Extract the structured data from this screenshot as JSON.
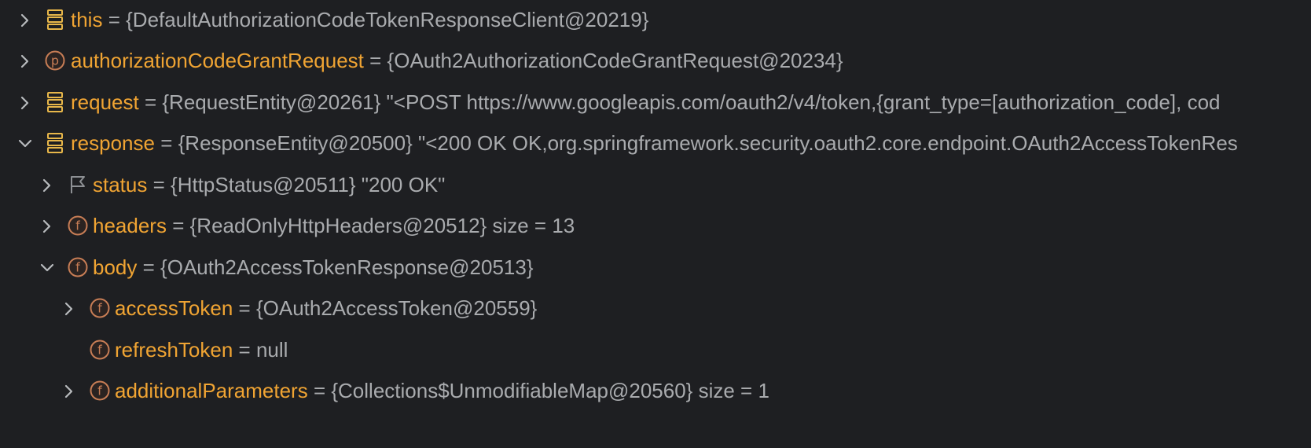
{
  "variables_panel": {
    "rows": [
      {
        "name": "this",
        "value": "= {DefaultAuthorizationCodeTokenResponseClient@20219}",
        "icon": "object-stack-icon",
        "toggle": "collapsed"
      },
      {
        "name": "authorizationCodeGrantRequest",
        "value": "= {OAuth2AuthorizationCodeGrantRequest@20234}",
        "icon": "parameter-icon",
        "icon_letter": "p",
        "toggle": "collapsed"
      },
      {
        "name": "request",
        "value": "= {RequestEntity@20261} \"<POST https://www.googleapis.com/oauth2/v4/token,{grant_type=[authorization_code], cod",
        "icon": "object-stack-icon",
        "toggle": "collapsed"
      },
      {
        "name": "response",
        "value": "= {ResponseEntity@20500} \"<200 OK OK,org.springframework.security.oauth2.core.endpoint.OAuth2AccessTokenRes",
        "icon": "object-stack-icon",
        "toggle": "expanded"
      },
      {
        "name": "status",
        "value": "= {HttpStatus@20511} \"200 OK\"",
        "icon": "flag-icon",
        "toggle": "collapsed"
      },
      {
        "name": "headers",
        "value": "= {ReadOnlyHttpHeaders@20512}  size = 13",
        "icon": "field-icon",
        "icon_letter": "f",
        "toggle": "collapsed"
      },
      {
        "name": "body",
        "value": "= {OAuth2AccessTokenResponse@20513}",
        "icon": "field-icon",
        "icon_letter": "f",
        "toggle": "expanded"
      },
      {
        "name": "accessToken",
        "value": "= {OAuth2AccessToken@20559}",
        "icon": "field-icon",
        "icon_letter": "f",
        "toggle": "collapsed"
      },
      {
        "name": "refreshToken",
        "value": "= null",
        "icon": "field-icon",
        "icon_letter": "f",
        "toggle": "none"
      },
      {
        "name": "additionalParameters",
        "value": "= {Collections$UnmodifiableMap@20560}  size = 1",
        "icon": "field-icon",
        "icon_letter": "f",
        "toggle": "collapsed"
      }
    ]
  },
  "colors": {
    "background": "#1e1f22",
    "variable_name": "#f0a433",
    "value_text": "#a9abae",
    "field_icon": "#c77d55",
    "stack_icon": "#e8b74a",
    "toggle_arrow": "#b8bbbe"
  }
}
